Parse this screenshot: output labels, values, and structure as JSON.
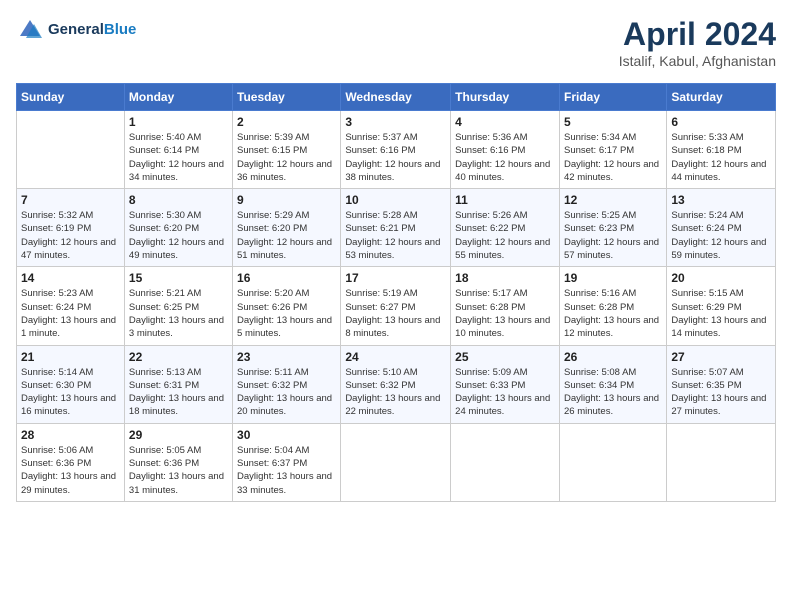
{
  "header": {
    "logo_line1": "General",
    "logo_line2": "Blue",
    "title": "April 2024",
    "subtitle": "Istalif, Kabul, Afghanistan"
  },
  "calendar": {
    "days_of_week": [
      "Sunday",
      "Monday",
      "Tuesday",
      "Wednesday",
      "Thursday",
      "Friday",
      "Saturday"
    ],
    "weeks": [
      [
        {
          "day": "",
          "sunrise": "",
          "sunset": "",
          "daylight": ""
        },
        {
          "day": "1",
          "sunrise": "Sunrise: 5:40 AM",
          "sunset": "Sunset: 6:14 PM",
          "daylight": "Daylight: 12 hours and 34 minutes."
        },
        {
          "day": "2",
          "sunrise": "Sunrise: 5:39 AM",
          "sunset": "Sunset: 6:15 PM",
          "daylight": "Daylight: 12 hours and 36 minutes."
        },
        {
          "day": "3",
          "sunrise": "Sunrise: 5:37 AM",
          "sunset": "Sunset: 6:16 PM",
          "daylight": "Daylight: 12 hours and 38 minutes."
        },
        {
          "day": "4",
          "sunrise": "Sunrise: 5:36 AM",
          "sunset": "Sunset: 6:16 PM",
          "daylight": "Daylight: 12 hours and 40 minutes."
        },
        {
          "day": "5",
          "sunrise": "Sunrise: 5:34 AM",
          "sunset": "Sunset: 6:17 PM",
          "daylight": "Daylight: 12 hours and 42 minutes."
        },
        {
          "day": "6",
          "sunrise": "Sunrise: 5:33 AM",
          "sunset": "Sunset: 6:18 PM",
          "daylight": "Daylight: 12 hours and 44 minutes."
        }
      ],
      [
        {
          "day": "7",
          "sunrise": "Sunrise: 5:32 AM",
          "sunset": "Sunset: 6:19 PM",
          "daylight": "Daylight: 12 hours and 47 minutes."
        },
        {
          "day": "8",
          "sunrise": "Sunrise: 5:30 AM",
          "sunset": "Sunset: 6:20 PM",
          "daylight": "Daylight: 12 hours and 49 minutes."
        },
        {
          "day": "9",
          "sunrise": "Sunrise: 5:29 AM",
          "sunset": "Sunset: 6:20 PM",
          "daylight": "Daylight: 12 hours and 51 minutes."
        },
        {
          "day": "10",
          "sunrise": "Sunrise: 5:28 AM",
          "sunset": "Sunset: 6:21 PM",
          "daylight": "Daylight: 12 hours and 53 minutes."
        },
        {
          "day": "11",
          "sunrise": "Sunrise: 5:26 AM",
          "sunset": "Sunset: 6:22 PM",
          "daylight": "Daylight: 12 hours and 55 minutes."
        },
        {
          "day": "12",
          "sunrise": "Sunrise: 5:25 AM",
          "sunset": "Sunset: 6:23 PM",
          "daylight": "Daylight: 12 hours and 57 minutes."
        },
        {
          "day": "13",
          "sunrise": "Sunrise: 5:24 AM",
          "sunset": "Sunset: 6:24 PM",
          "daylight": "Daylight: 12 hours and 59 minutes."
        }
      ],
      [
        {
          "day": "14",
          "sunrise": "Sunrise: 5:23 AM",
          "sunset": "Sunset: 6:24 PM",
          "daylight": "Daylight: 13 hours and 1 minute."
        },
        {
          "day": "15",
          "sunrise": "Sunrise: 5:21 AM",
          "sunset": "Sunset: 6:25 PM",
          "daylight": "Daylight: 13 hours and 3 minutes."
        },
        {
          "day": "16",
          "sunrise": "Sunrise: 5:20 AM",
          "sunset": "Sunset: 6:26 PM",
          "daylight": "Daylight: 13 hours and 5 minutes."
        },
        {
          "day": "17",
          "sunrise": "Sunrise: 5:19 AM",
          "sunset": "Sunset: 6:27 PM",
          "daylight": "Daylight: 13 hours and 8 minutes."
        },
        {
          "day": "18",
          "sunrise": "Sunrise: 5:17 AM",
          "sunset": "Sunset: 6:28 PM",
          "daylight": "Daylight: 13 hours and 10 minutes."
        },
        {
          "day": "19",
          "sunrise": "Sunrise: 5:16 AM",
          "sunset": "Sunset: 6:28 PM",
          "daylight": "Daylight: 13 hours and 12 minutes."
        },
        {
          "day": "20",
          "sunrise": "Sunrise: 5:15 AM",
          "sunset": "Sunset: 6:29 PM",
          "daylight": "Daylight: 13 hours and 14 minutes."
        }
      ],
      [
        {
          "day": "21",
          "sunrise": "Sunrise: 5:14 AM",
          "sunset": "Sunset: 6:30 PM",
          "daylight": "Daylight: 13 hours and 16 minutes."
        },
        {
          "day": "22",
          "sunrise": "Sunrise: 5:13 AM",
          "sunset": "Sunset: 6:31 PM",
          "daylight": "Daylight: 13 hours and 18 minutes."
        },
        {
          "day": "23",
          "sunrise": "Sunrise: 5:11 AM",
          "sunset": "Sunset: 6:32 PM",
          "daylight": "Daylight: 13 hours and 20 minutes."
        },
        {
          "day": "24",
          "sunrise": "Sunrise: 5:10 AM",
          "sunset": "Sunset: 6:32 PM",
          "daylight": "Daylight: 13 hours and 22 minutes."
        },
        {
          "day": "25",
          "sunrise": "Sunrise: 5:09 AM",
          "sunset": "Sunset: 6:33 PM",
          "daylight": "Daylight: 13 hours and 24 minutes."
        },
        {
          "day": "26",
          "sunrise": "Sunrise: 5:08 AM",
          "sunset": "Sunset: 6:34 PM",
          "daylight": "Daylight: 13 hours and 26 minutes."
        },
        {
          "day": "27",
          "sunrise": "Sunrise: 5:07 AM",
          "sunset": "Sunset: 6:35 PM",
          "daylight": "Daylight: 13 hours and 27 minutes."
        }
      ],
      [
        {
          "day": "28",
          "sunrise": "Sunrise: 5:06 AM",
          "sunset": "Sunset: 6:36 PM",
          "daylight": "Daylight: 13 hours and 29 minutes."
        },
        {
          "day": "29",
          "sunrise": "Sunrise: 5:05 AM",
          "sunset": "Sunset: 6:36 PM",
          "daylight": "Daylight: 13 hours and 31 minutes."
        },
        {
          "day": "30",
          "sunrise": "Sunrise: 5:04 AM",
          "sunset": "Sunset: 6:37 PM",
          "daylight": "Daylight: 13 hours and 33 minutes."
        },
        {
          "day": "",
          "sunrise": "",
          "sunset": "",
          "daylight": ""
        },
        {
          "day": "",
          "sunrise": "",
          "sunset": "",
          "daylight": ""
        },
        {
          "day": "",
          "sunrise": "",
          "sunset": "",
          "daylight": ""
        },
        {
          "day": "",
          "sunrise": "",
          "sunset": "",
          "daylight": ""
        }
      ]
    ]
  }
}
